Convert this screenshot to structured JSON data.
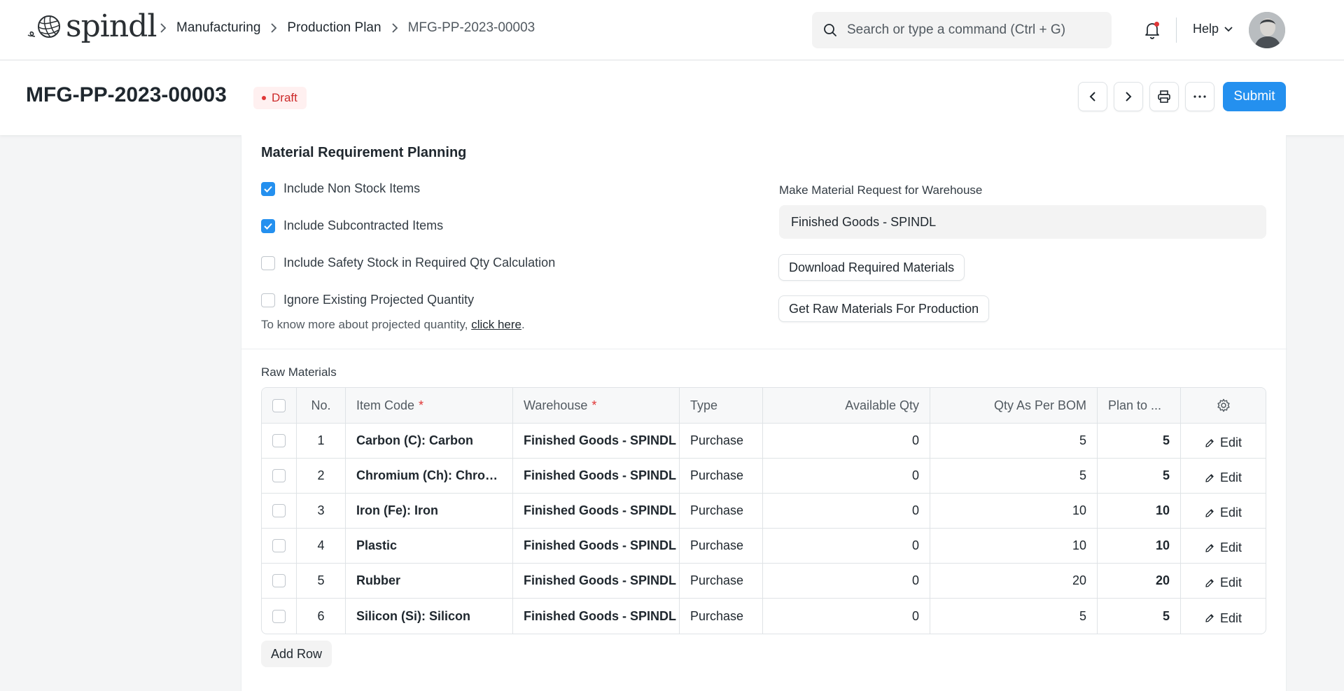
{
  "brand": {
    "name": "spindl"
  },
  "breadcrumb": [
    {
      "label": "Manufacturing"
    },
    {
      "label": "Production Plan"
    },
    {
      "label": "MFG-PP-2023-00003"
    }
  ],
  "search": {
    "placeholder": "Search or type a command (Ctrl + G)"
  },
  "help": {
    "label": "Help"
  },
  "page": {
    "title": "MFG-PP-2023-00003",
    "status": "Draft",
    "submit_label": "Submit"
  },
  "mrp": {
    "title": "Material Requirement Planning",
    "checks": [
      {
        "label": "Include Non Stock Items",
        "checked": true
      },
      {
        "label": "Include Subcontracted Items",
        "checked": true
      },
      {
        "label": "Include Safety Stock in Required Qty Calculation",
        "checked": false
      },
      {
        "label": "Ignore Existing Projected Quantity",
        "checked": false
      }
    ],
    "note_text": "To know more about projected quantity,",
    "note_link": "click here",
    "note_end": ".",
    "warehouse_label": "Make Material Request for Warehouse",
    "warehouse_value": "Finished Goods - SPINDL",
    "download_label": "Download Required Materials",
    "get_raw_label": "Get Raw Materials For Production"
  },
  "raw_materials": {
    "label": "Raw Materials",
    "columns": {
      "no": "No.",
      "item_code": "Item Code",
      "warehouse": "Warehouse",
      "type": "Type",
      "available_qty": "Available Qty",
      "qty_bom": "Qty As Per BOM",
      "plan": "Plan to ..."
    },
    "required_mark": "*",
    "edit_label": "Edit",
    "rows": [
      {
        "no": "1",
        "item_code": "Carbon (C): Carbon",
        "warehouse": "Finished Goods - SPINDL",
        "type": "Purchase",
        "available_qty": "0",
        "qty_bom": "5",
        "plan": "5"
      },
      {
        "no": "2",
        "item_code": "Chromium (Ch): Chrom...",
        "warehouse": "Finished Goods - SPINDL",
        "type": "Purchase",
        "available_qty": "0",
        "qty_bom": "5",
        "plan": "5"
      },
      {
        "no": "3",
        "item_code": "Iron (Fe): Iron",
        "warehouse": "Finished Goods - SPINDL",
        "type": "Purchase",
        "available_qty": "0",
        "qty_bom": "10",
        "plan": "10"
      },
      {
        "no": "4",
        "item_code": "Plastic",
        "warehouse": "Finished Goods - SPINDL",
        "type": "Purchase",
        "available_qty": "0",
        "qty_bom": "10",
        "plan": "10"
      },
      {
        "no": "5",
        "item_code": "Rubber",
        "warehouse": "Finished Goods - SPINDL",
        "type": "Purchase",
        "available_qty": "0",
        "qty_bom": "20",
        "plan": "20"
      },
      {
        "no": "6",
        "item_code": "Silicon (Si): Silicon",
        "warehouse": "Finished Goods - SPINDL",
        "type": "Purchase",
        "available_qty": "0",
        "qty_bom": "5",
        "plan": "5"
      }
    ],
    "add_row_label": "Add Row"
  },
  "icons": {
    "logo": "yarn-ball-icon",
    "search": "search-icon",
    "bell": "bell-icon",
    "help_chevron": "chevron-down-icon",
    "prev": "chevron-left-icon",
    "next": "chevron-right-icon",
    "print": "printer-icon",
    "more": "more-icon",
    "settings": "gear-icon",
    "edit": "pencil-icon"
  },
  "colors": {
    "primary": "#2490ef",
    "draft_bg": "#fff0f0",
    "draft_text": "#cc2929",
    "required": "#e03636"
  }
}
